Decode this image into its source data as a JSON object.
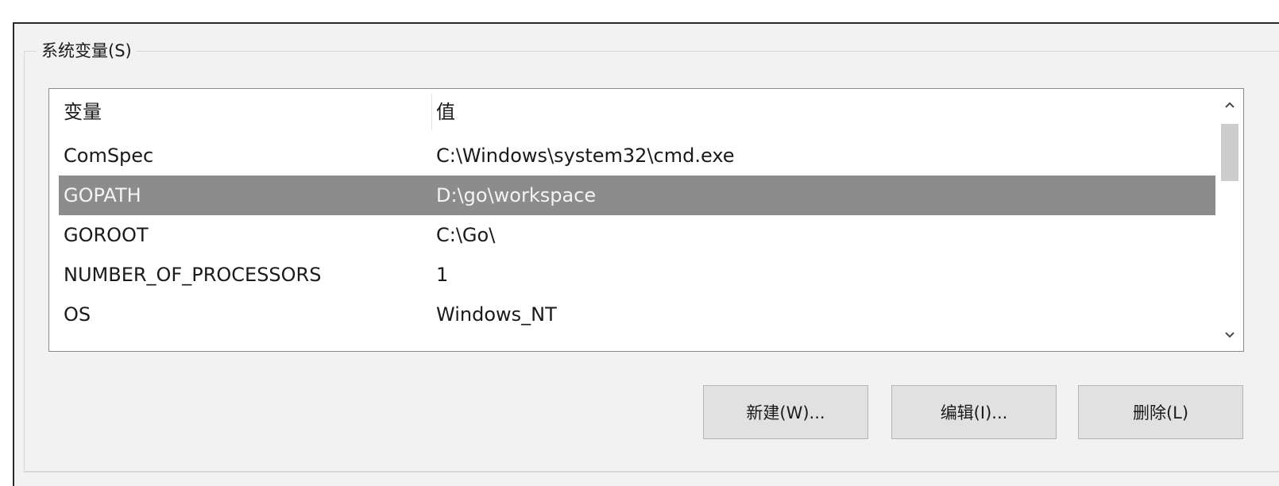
{
  "group": {
    "title": "系统变量(S)"
  },
  "list": {
    "columns": {
      "name": "变量",
      "value": "值"
    },
    "rows": [
      {
        "name": "ComSpec",
        "value": "C:\\Windows\\system32\\cmd.exe",
        "selected": false
      },
      {
        "name": "GOPATH",
        "value": "D:\\go\\workspace",
        "selected": true
      },
      {
        "name": "GOROOT",
        "value": "C:\\Go\\",
        "selected": false
      },
      {
        "name": "NUMBER_OF_PROCESSORS",
        "value": "1",
        "selected": false
      },
      {
        "name": "OS",
        "value": "Windows_NT",
        "selected": false
      }
    ]
  },
  "scrollbar": {
    "up_icon": "^",
    "down_icon": "v"
  },
  "buttons": {
    "new_label": "新建(W)...",
    "edit_label": "编辑(I)...",
    "delete_label": "删除(L)"
  }
}
